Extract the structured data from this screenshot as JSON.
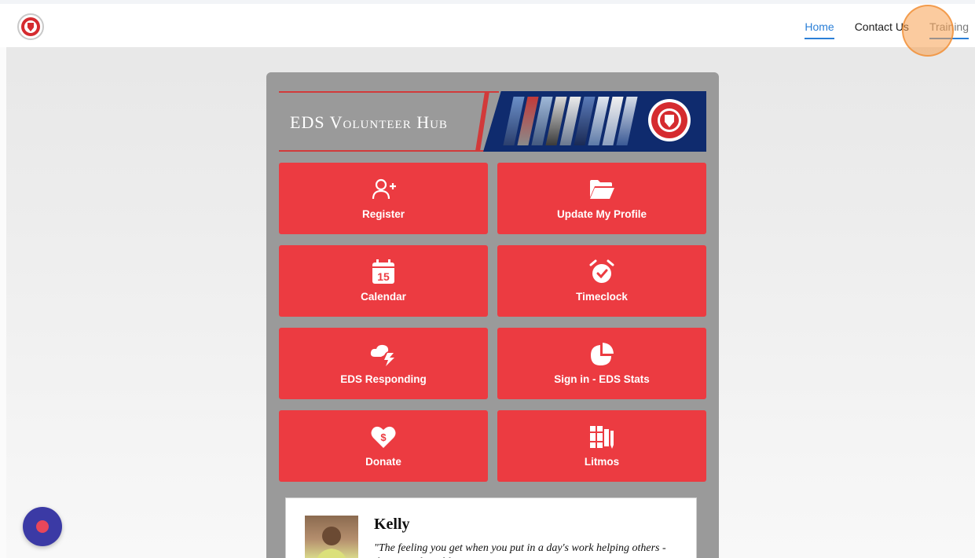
{
  "nav": {
    "home": "Home",
    "contact": "Contact Us",
    "training": "Training"
  },
  "banner": {
    "title": "EDS Volunteer Hub"
  },
  "tiles": [
    {
      "label": "Register",
      "icon": "user-plus-icon"
    },
    {
      "label": "Update My Profile",
      "icon": "folder-open-icon"
    },
    {
      "label": "Calendar",
      "icon": "calendar-icon"
    },
    {
      "label": "Timeclock",
      "icon": "alarm-clock-icon"
    },
    {
      "label": "EDS Responding",
      "icon": "storm-bolt-icon"
    },
    {
      "label": "Sign in - EDS Stats",
      "icon": "pie-chart-icon"
    },
    {
      "label": "Donate",
      "icon": "heart-dollar-icon"
    },
    {
      "label": "Litmos",
      "icon": "books-icon"
    }
  ],
  "calendar_day": "15",
  "testimonial": {
    "name": "Kelly",
    "quote": "\"The feeling you get when you put in a day's work helping others - there's nothing like it!\""
  },
  "colors": {
    "tile_red": "#ec3b41",
    "panel_gray": "#9a9a9a",
    "banner_blue": "#0f2b6e",
    "nav_active": "#2b7fd7",
    "chat_button": "#3b3aa5"
  }
}
